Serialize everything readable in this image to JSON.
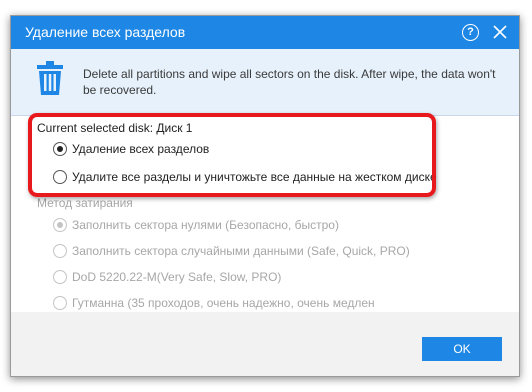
{
  "dialog": {
    "title": "Удаление всех разделов",
    "help_glyph": "?",
    "icons": {
      "help": "help-icon",
      "close": "close-icon",
      "banner": "trash-icon"
    },
    "colors": {
      "accent": "#1e87e5",
      "highlight": "#e8191d",
      "banner_bg": "#e6f1fb"
    }
  },
  "banner": {
    "text": "Delete all partitions and wipe all sectors on the disk. After wipe, the data won't be recovered."
  },
  "content": {
    "current_disk": "Current selected disk: Диск 1",
    "options": [
      {
        "label": "Удаление всех разделов",
        "checked": true
      },
      {
        "label": "Удалите все разделы и уничтожьте все данные на жестком диске",
        "checked": false
      }
    ],
    "wipe_method_label": "Метод затирания",
    "wipe_methods": [
      {
        "label": "Заполнить сектора нулями (Безопасно, быстро)",
        "checked": true
      },
      {
        "label": "Заполнить сектора случайными данными (Safe, Quick, PRO)",
        "checked": false
      },
      {
        "label": "DoD 5220.22-M(Very Safe, Slow, PRO)",
        "checked": false
      },
      {
        "label": "Гутманна (35 проходов, очень надежно, очень медлен",
        "checked": false
      }
    ]
  },
  "footer": {
    "ok_label": "OK"
  }
}
